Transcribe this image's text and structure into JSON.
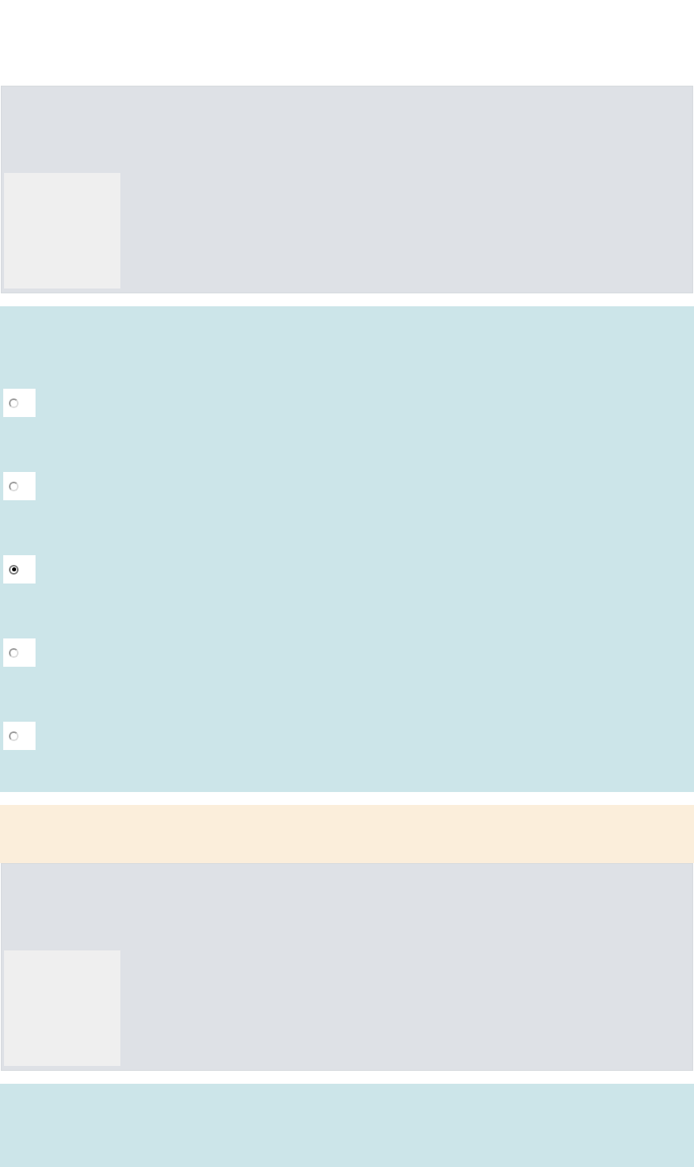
{
  "sections": [
    {
      "kind": "image_question"
    },
    {
      "kind": "choice_question",
      "options": [
        {
          "selected": false
        },
        {
          "selected": false
        },
        {
          "selected": true
        },
        {
          "selected": false
        },
        {
          "selected": false
        }
      ]
    },
    {
      "kind": "notice"
    },
    {
      "kind": "image_question"
    },
    {
      "kind": "choice_question"
    }
  ]
}
